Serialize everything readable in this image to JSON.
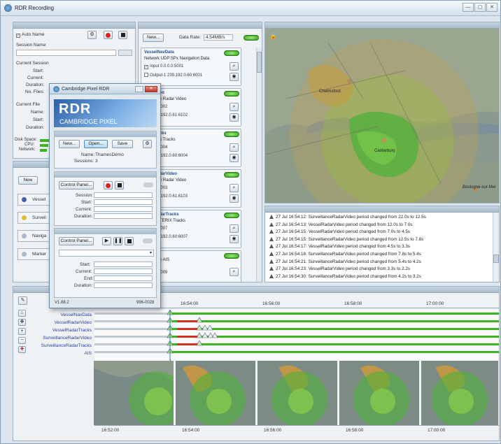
{
  "window": {
    "title": "RDR Recording",
    "controls": [
      "—",
      "▢",
      "✕"
    ]
  },
  "recording": {
    "auto_name_label": "Auto Name",
    "session_name_label": "Session Name:",
    "current_session_label": "Current Session",
    "start_label": "Start:",
    "current_label": "Current:",
    "duration_label": "Duration:",
    "no_files_label": "No. Files:",
    "current_file_label": "Current File",
    "name_label": "Name:",
    "file_start_label": "Start:",
    "file_duration_label": "Duration:",
    "disk_space_label": "Disk Space:",
    "cpu_label": "CPU:",
    "network_label": "Network:"
  },
  "sources_panel": {
    "new_button": "New",
    "items": [
      "Vessel",
      "Surveil",
      "Naviga",
      "Marker"
    ]
  },
  "inputs": {
    "new_button": "New...",
    "data_rate_label": "Data Rate:",
    "data_rate_value": "4.54MB/s",
    "cards": [
      {
        "title": "VesselNavData",
        "desc": "Network UDP SPx Navigation Data",
        "input": "Input 0.0.0.0:5001",
        "output": "Output-1 239.192.0.60:6001"
      },
      {
        "title": "adarVideo",
        "desc": "UDP SPx Radar Video",
        "input": "0.0.0.0:5002",
        "output": "ut-1 239.192.0.61:6102"
      },
      {
        "title": "adarTracks",
        "desc": "UDP SPx Tracks",
        "input": "0.0.0.0:5004",
        "output": "ut-1 239.192.0.60:6004"
      },
      {
        "title": "anceRadarVideo",
        "desc": "UDP SPx Radar Video",
        "input": "0.0.0.0:5003",
        "output": "ut-1 239.192.0.61:6103"
      },
      {
        "title": "anceRadarTracks",
        "desc": "UDP ASTERIX Tracks",
        "input": "0.0.0.0:5007",
        "output": "ut-1 239.192.0.60:6007"
      },
      {
        "title": "",
        "desc": "UDP SPx AIS",
        "input": "0.0.0.0:5009",
        "output": ""
      }
    ]
  },
  "map": {
    "places": [
      "Chelmsford",
      "Canterbury",
      "Boulogne-sur-Mer"
    ]
  },
  "messages": [
    "27 Jul 16:54:12: SurveillanceRadarVideo period changed from 22.0s to 12.5s",
    "27 Jul 16:54:13: VesselRadarVideo period changed from 12.0s to 7.0s",
    "27 Jul 16:54:15: VesselRadarVideo period changed from 7.0s to 4.5s",
    "27 Jul 16:54:15: SurveillanceRadarVideo period changed from 12.5s to 7.8s",
    "27 Jul 16:54:17: VesselRadarVideo period changed from 4.5s to 3.3s",
    "27 Jul 16:54:18: SurveillanceRadarVideo period changed from 7.8s to 5.4s",
    "27 Jul 16:54:21: SurveillanceRadarVideo period changed from 5.4s to 4.2s",
    "27 Jul 16:54:23: VesselRadarVideo period changed from 3.3s to 2.2s",
    "27 Jul 16:54:30: SurveillanceRadarVideo period changed from 4.2s to 3.2s"
  ],
  "timeline": {
    "top_ticks": [
      "16:54:00",
      "16:56:00",
      "16:58:00",
      "17:00:00"
    ],
    "bottom_ticks": [
      "16:52:00",
      "16:54:00",
      "16:56:00",
      "16:58:00",
      "17:00:00"
    ],
    "tracks": [
      "VesselNavData",
      "VesselRadarVideo",
      "VesselRadarTracks",
      "SurveillanceRadarVideo",
      "SurveillanceRadarTracks",
      "AIS"
    ]
  },
  "dialog": {
    "title": "Cambridge Pixel RDR",
    "logo_big": "RDR",
    "logo_small": "CAMBRIDGE PIXEL",
    "new_button": "New...",
    "open_button": "Open...",
    "save_button": "Save",
    "name_label": "Name:",
    "name_value": "ThamesDemo",
    "sessions_label": "Sessions:",
    "sessions_value": "3",
    "control_panel_button": "Control Panel...",
    "session_label": "Session:",
    "start_label": "Start:",
    "current_label": "Current:",
    "duration_label": "Duration:",
    "control_panel_button_2": "Control Panel...",
    "start_label_2": "Start:",
    "current_label_2": "Current:",
    "end_label": "End:",
    "duration_label_2": "Duration:",
    "version": "V1.88.2",
    "code": "996-0028"
  },
  "colors": {
    "accent": "#2a3d99",
    "led": "#3cb521",
    "record": "#e02020"
  }
}
